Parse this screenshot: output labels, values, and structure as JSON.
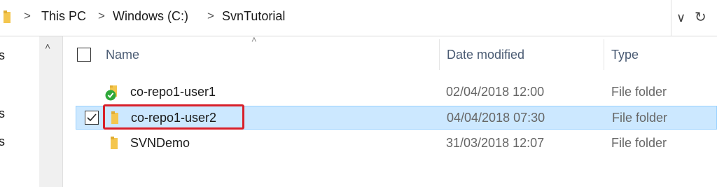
{
  "address_bar": {
    "breadcrumbs": [
      "This PC",
      "Windows (C:)",
      "SvnTutorial"
    ],
    "separator": ">",
    "dropdown_glyph": "∨",
    "refresh_glyph": "↻",
    "icons": [
      "folder-icon",
      "chevron-down-icon",
      "refresh-icon"
    ]
  },
  "nav_pane": {
    "fragments": [
      "s",
      "s",
      "s"
    ],
    "scroll_up_glyph": "˄"
  },
  "columns": {
    "sort_glyph": "˄",
    "name": "Name",
    "date": "Date modified",
    "type": "Type"
  },
  "files": [
    {
      "name": "co-repo1-user1",
      "date": "02/04/2018 12:00",
      "type": "File folder",
      "icon": "svn-folder-ok-icon",
      "selected": false
    },
    {
      "name": "co-repo1-user2",
      "date": "04/04/2018 07:30",
      "type": "File folder",
      "icon": "folder-icon",
      "selected": true
    },
    {
      "name": "SVNDemo",
      "date": "31/03/2018 12:07",
      "type": "File folder",
      "icon": "folder-icon",
      "selected": false
    }
  ],
  "colors": {
    "selection": "#cce8ff",
    "selection_border": "#99d1ff",
    "highlight_box": "#d8202a",
    "folder": "#f4c64e",
    "svn_ok": "#2fa83a"
  }
}
